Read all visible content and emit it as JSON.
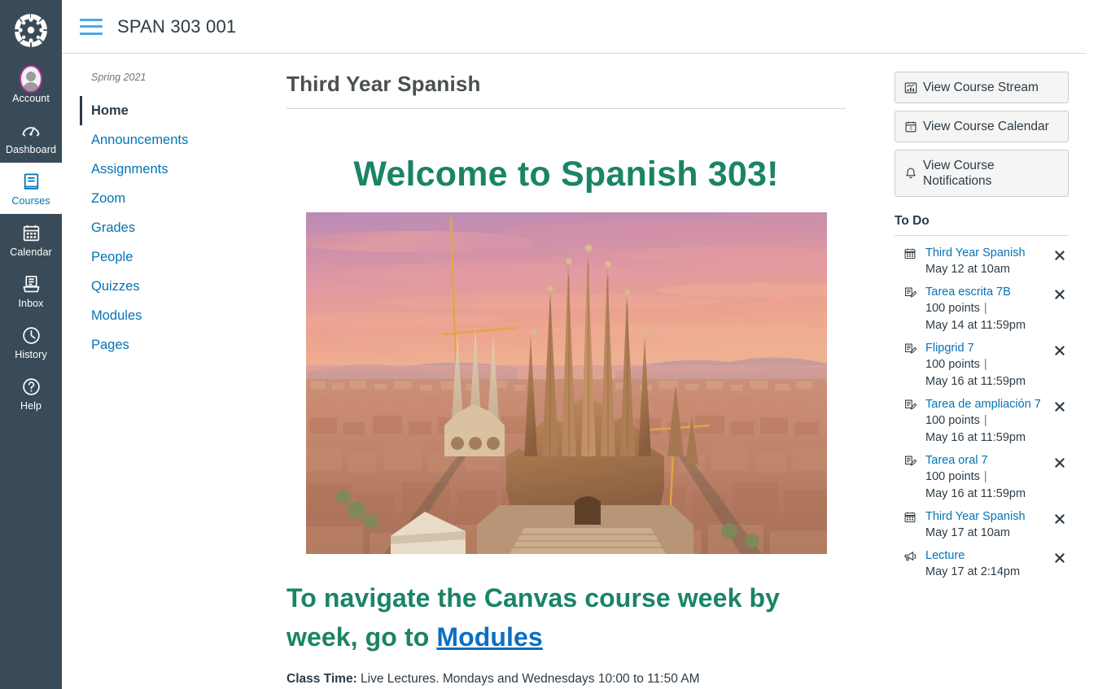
{
  "global_nav": {
    "logo_name": "canvas-logo",
    "items": [
      {
        "label": "Account",
        "icon": "avatar-icon",
        "active": false
      },
      {
        "label": "Dashboard",
        "icon": "dashboard-gauge-icon",
        "active": false
      },
      {
        "label": "Courses",
        "icon": "courses-book-icon",
        "active": true
      },
      {
        "label": "Calendar",
        "icon": "calendar-icon",
        "active": false
      },
      {
        "label": "Inbox",
        "icon": "inbox-tray-icon",
        "active": false
      },
      {
        "label": "History",
        "icon": "clock-icon",
        "active": false
      },
      {
        "label": "Help",
        "icon": "question-circle-icon",
        "active": false
      }
    ]
  },
  "topbar": {
    "menu_icon": "hamburger-icon",
    "course_code": "SPAN 303 001"
  },
  "course_nav": {
    "term": "Spring 2021",
    "items": [
      {
        "label": "Home",
        "active": true
      },
      {
        "label": "Announcements",
        "active": false
      },
      {
        "label": "Assignments",
        "active": false
      },
      {
        "label": "Zoom",
        "active": false
      },
      {
        "label": "Grades",
        "active": false
      },
      {
        "label": "People",
        "active": false
      },
      {
        "label": "Quizzes",
        "active": false
      },
      {
        "label": "Modules",
        "active": false
      },
      {
        "label": "Pages",
        "active": false
      }
    ]
  },
  "main": {
    "page_title": "Third Year Spanish",
    "welcome_heading": "Welcome to Spanish 303!",
    "hero_image_alt": "Aerial photo of the Sagrada Familia basilica in Barcelona at sunset",
    "navigate_heading_prefix": "To navigate the Canvas course week by week, go to ",
    "navigate_heading_link": "Modules",
    "class_time_label": "Class Time:",
    "class_time_value": "Live Lectures. Mondays and Wednesdays 10:00 to 11:50 AM",
    "accent_green": "#1A8466",
    "link_blue": "#0A6FC2"
  },
  "sidebar": {
    "buttons": [
      {
        "label": "View Course Stream",
        "icon": "course-stream-chart-icon"
      },
      {
        "label": "View Course Calendar",
        "icon": "calendar-day-icon"
      },
      {
        "label": "View Course Notifications",
        "icon": "bell-icon"
      }
    ],
    "todo_heading": "To Do",
    "todo_items": [
      {
        "icon": "calendar-event-icon",
        "title": "Third Year Spanish",
        "points": "",
        "due": "May 12 at 10am",
        "dismiss": "dismiss-icon"
      },
      {
        "icon": "assignment-icon",
        "title": "Tarea escrita 7B",
        "points": "100 points",
        "due": "May 14 at 11:59pm",
        "dismiss": "dismiss-icon"
      },
      {
        "icon": "assignment-icon",
        "title": "Flipgrid 7",
        "points": "100 points",
        "due": "May 16 at 11:59pm",
        "dismiss": "dismiss-icon"
      },
      {
        "icon": "assignment-icon",
        "title": "Tarea de ampliación 7",
        "points": "100 points",
        "due": "May 16 at 11:59pm",
        "dismiss": "dismiss-icon"
      },
      {
        "icon": "assignment-icon",
        "title": "Tarea oral 7",
        "points": "100 points",
        "due": "May 16 at 11:59pm",
        "dismiss": "dismiss-icon"
      },
      {
        "icon": "calendar-event-icon",
        "title": "Third Year Spanish",
        "points": "",
        "due": "May 17 at 10am",
        "dismiss": "dismiss-icon"
      },
      {
        "icon": "announcement-megaphone-icon",
        "title": "Lecture",
        "points": "",
        "due": "May 17 at 2:14pm",
        "dismiss": "dismiss-icon"
      }
    ]
  }
}
